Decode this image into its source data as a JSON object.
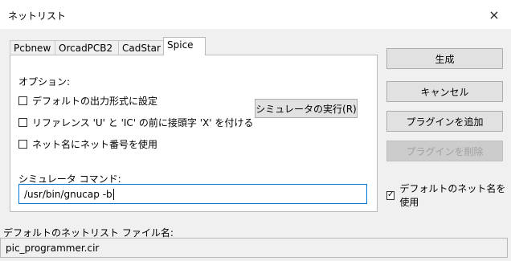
{
  "window": {
    "title": "ネットリスト",
    "close_glyph": "×"
  },
  "tabs": [
    {
      "label": "Pcbnew",
      "active": false
    },
    {
      "label": "OrcadPCB2",
      "active": false
    },
    {
      "label": "CadStar",
      "active": false
    },
    {
      "label": "Spice",
      "active": true
    }
  ],
  "options": {
    "heading": "オプション:",
    "checkboxes": [
      {
        "label": "デフォルトの出力形式に設定",
        "checked": false
      },
      {
        "label": "リファレンス 'U' と 'IC' の前に接頭字 'X' を付ける",
        "checked": false
      },
      {
        "label": "ネット名にネット番号を使用",
        "checked": false
      }
    ],
    "run_simulator_button": "シミュレータの実行(R)"
  },
  "simulator": {
    "label": "シミュレータ コマンド:",
    "command": "/usr/bin/gnucap -b"
  },
  "side_buttons": {
    "generate": "生成",
    "cancel": "キャンセル",
    "add_plugin": "プラグインを追加",
    "remove_plugin": "プラグインを削除",
    "remove_plugin_enabled": false
  },
  "use_default_netname": {
    "label": "デフォルトのネット名を使用",
    "checked": true
  },
  "default_filename": {
    "label": "デフォルトのネットリスト ファイル名:",
    "value": "pic_programmer.cir"
  }
}
